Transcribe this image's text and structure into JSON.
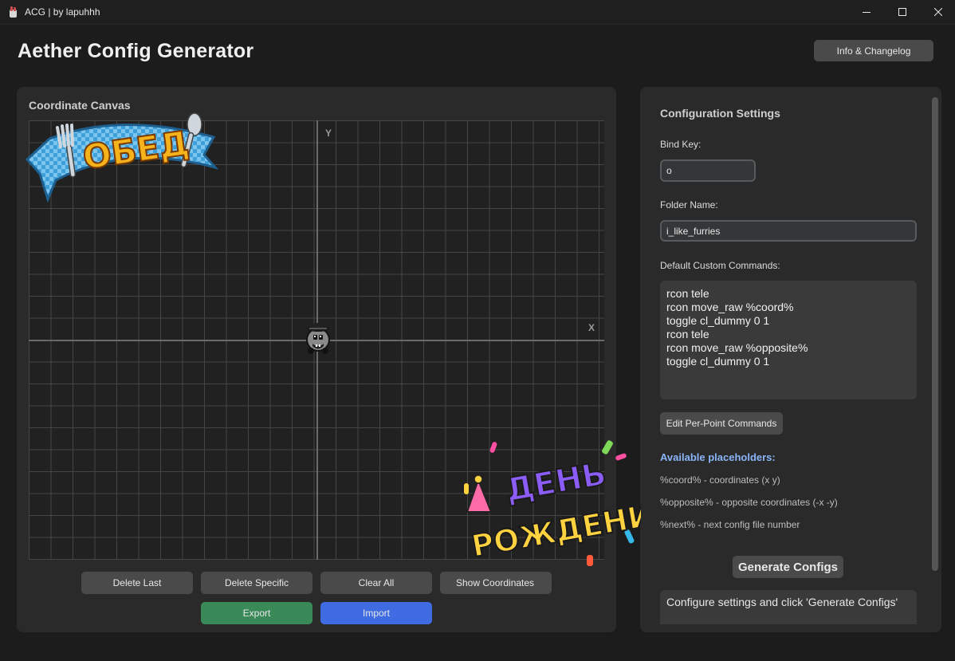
{
  "window": {
    "title": "ACG | by lapuhhh"
  },
  "header": {
    "title": "Aether Config Generator",
    "info_button": "Info & Changelog"
  },
  "canvas": {
    "title": "Coordinate Canvas",
    "x_axis_label": "X",
    "y_axis_label": "Y",
    "buttons": {
      "delete_last": "Delete Last",
      "delete_specific": "Delete Specific",
      "clear_all": "Clear All",
      "show_coordinates": "Show Coordinates",
      "export": "Export",
      "import": "Import"
    },
    "colors": {
      "export": "#3a8a59",
      "import": "#3f6ce3"
    }
  },
  "settings": {
    "title": "Configuration Settings",
    "bind_key_label": "Bind Key:",
    "bind_key_value": "o",
    "folder_name_label": "Folder Name:",
    "folder_name_value": "i_like_furries",
    "default_commands_label": "Default Custom Commands:",
    "default_commands": [
      "rcon tele",
      "rcon move_raw %coord%",
      "toggle cl_dummy 0 1",
      "rcon tele",
      "rcon move_raw %opposite%",
      "toggle cl_dummy 0 1"
    ],
    "edit_per_point_button": "Edit Per-Point Commands",
    "placeholders_title": "Available placeholders:",
    "placeholders": [
      "%coord% - coordinates (x y)",
      "%opposite% - opposite coordinates (-x -y)",
      "%next% - next config file number"
    ],
    "generate_button": "Generate Configs",
    "status_text": "Configure settings and click 'Generate Configs'"
  },
  "stickers": {
    "top_left_text": "ОБЕД",
    "bottom_right_line1": "ДЕНЬ",
    "bottom_right_line2": "РОЖДЕНИЯ"
  }
}
